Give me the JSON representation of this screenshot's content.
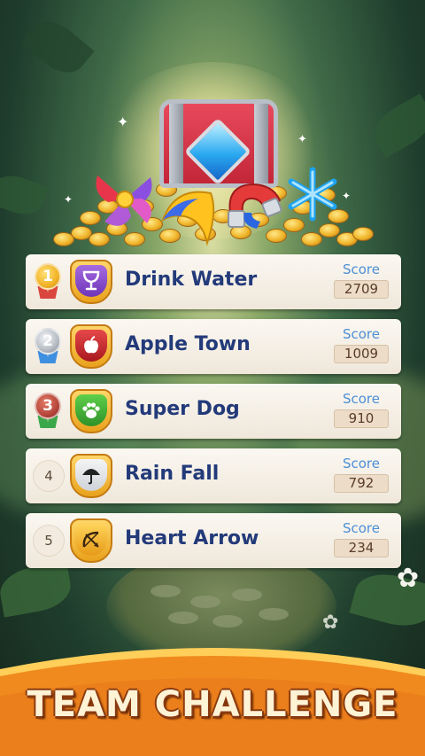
{
  "title": "TEAM CHALLENGE",
  "score_label": "Score",
  "teams": [
    {
      "rank": "1",
      "name": "Drink Water",
      "score": "2709",
      "icon": "goblet-icon",
      "medal": "gold"
    },
    {
      "rank": "2",
      "name": "Apple Town",
      "score": "1009",
      "icon": "apple-icon",
      "medal": "silver"
    },
    {
      "rank": "3",
      "name": "Super Dog",
      "score": "910",
      "icon": "paw-icon",
      "medal": "bronze"
    },
    {
      "rank": "4",
      "name": "Rain Fall",
      "score": "792",
      "icon": "umbrella-icon",
      "medal": "none"
    },
    {
      "rank": "5",
      "name": "Heart Arrow",
      "score": "234",
      "icon": "bow-arrow-icon",
      "medal": "none"
    }
  ],
  "treasure_items": [
    "treasure-chest-icon",
    "gold-coins",
    "pinwheel-candy-icon",
    "banana-boomerang-icon",
    "magnet-icon",
    "snowflake-icon"
  ],
  "colors": {
    "team_name": "#233a7a",
    "score_label": "#4c8fd6",
    "banner": "#f08a1e",
    "gold": "#f2b327",
    "silver": "#b7bcc4",
    "bronze": "#b7473c"
  }
}
